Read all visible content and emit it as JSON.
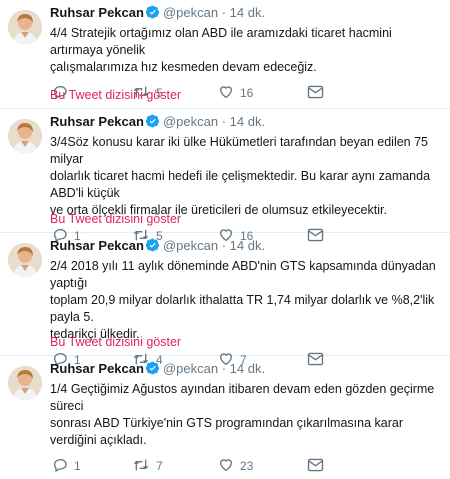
{
  "tweets": [
    {
      "name": "Ruhsar Pekcan",
      "handle": "@pekcan",
      "separator": "·",
      "time": "14 dk.",
      "text_lines": [
        "4/4 Stratejik ortağımız olan ABD ile aramızdaki ticaret hacmini artırmaya yönelik",
        "çalışmalarımıza hız kesmeden devam edeceğiz."
      ],
      "reply_count": "",
      "retweet_count": "5",
      "like_count": "16",
      "show_thread": "Bu Tweet dizisini göster"
    },
    {
      "name": "Ruhsar Pekcan",
      "handle": "@pekcan",
      "separator": "·",
      "time": "14 dk.",
      "text_lines": [
        "3/4Söz konusu karar iki ülke Hükümetleri tarafından beyan edilen 75 milyar",
        "dolarlık ticaret hacmi hedefi ile çelişmektedir. Bu karar aynı zamanda ABD'li küçük",
        "ve orta ölçekli firmalar ile üreticileri de olumsuz etkileyecektir."
      ],
      "reply_count": "1",
      "retweet_count": "5",
      "like_count": "16",
      "show_thread": "Bu Tweet dizisini göster"
    },
    {
      "name": "Ruhsar Pekcan",
      "handle": "@pekcan",
      "separator": "·",
      "time": "14 dk.",
      "text_lines": [
        "2/4 2018 yılı 11 aylık döneminde ABD'nin GTS kapsamında dünyadan yaptığı",
        "toplam 20,9 milyar dolarlık ithalatta TR 1,74 milyar dolarlık ve %8,2'lik payla 5.",
        "tedarikçi ülkedir."
      ],
      "reply_count": "1",
      "retweet_count": "4",
      "like_count": "7",
      "show_thread": "Bu Tweet dizisini göster"
    },
    {
      "name": "Ruhsar Pekcan",
      "handle": "@pekcan",
      "separator": "·",
      "time": "14 dk.",
      "text_lines": [
        "1/4 Geçtiğimiz Ağustos ayından itibaren devam eden gözden geçirme süreci",
        "sonrası ABD Türkiye'nin GTS programından çıkarılmasına karar verdiğini açıkladı."
      ],
      "reply_count": "1",
      "retweet_count": "7",
      "like_count": "23",
      "show_thread": ""
    }
  ],
  "icons": {
    "reply": "reply-icon",
    "retweet": "retweet-icon",
    "like": "heart-icon",
    "message": "direct-message-icon",
    "verified": "verified-badge-icon"
  },
  "colors": {
    "text": "#14171a",
    "muted": "#657786",
    "verified": "#1da1f2",
    "thread_link": "#e0245e",
    "divider": "#e6ecf0"
  }
}
